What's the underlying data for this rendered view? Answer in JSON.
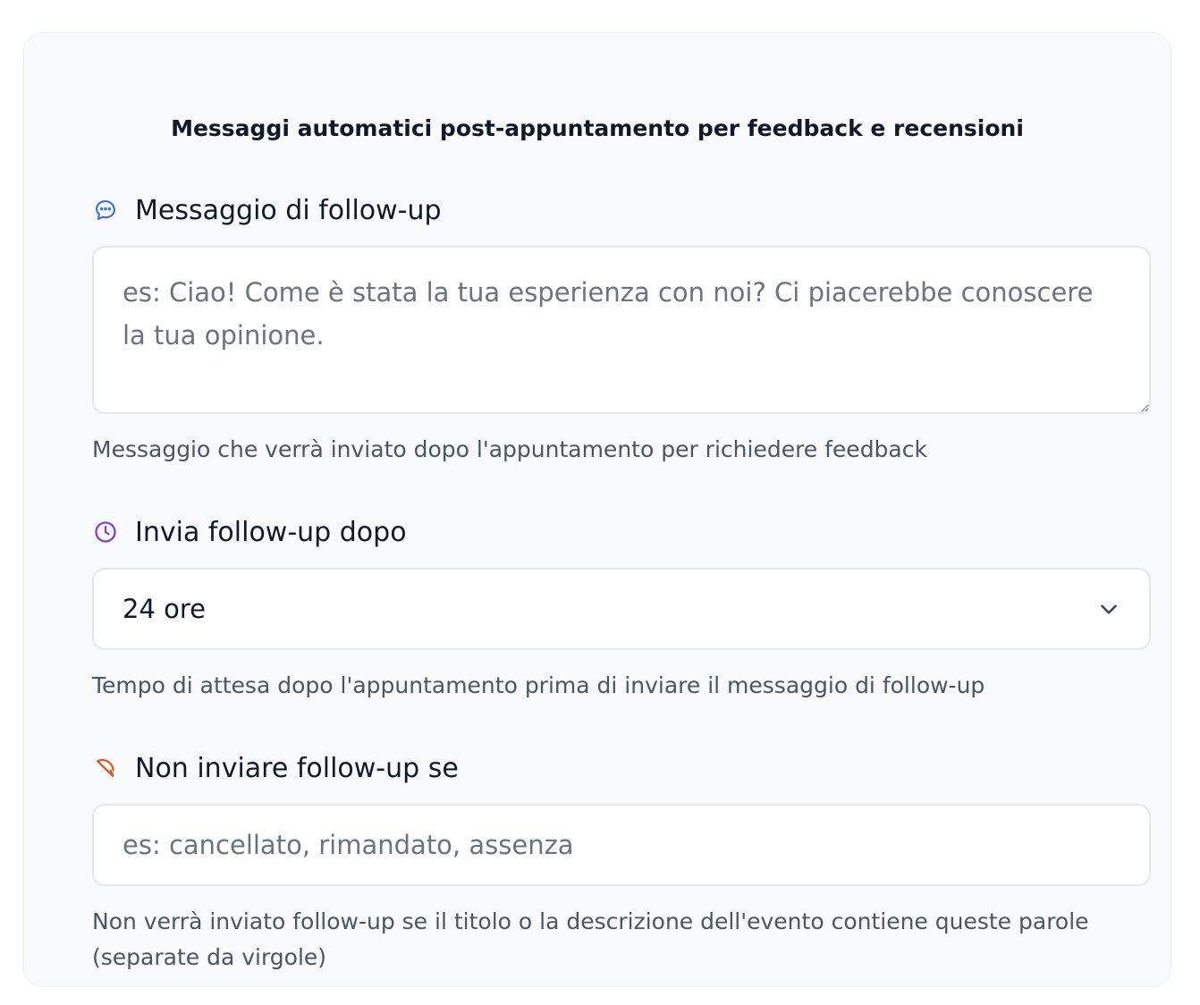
{
  "card": {
    "title": "Messaggi automatici post-appuntamento per feedback e recensioni"
  },
  "followup_message": {
    "label": "Messaggio di follow-up",
    "icon": "chat-bubble-icon",
    "icon_color": "#3b6fd8",
    "value": "",
    "placeholder": "es: Ciao! Come è stata la tua esperienza con noi? Ci piacerebbe conoscere la tua opinione.",
    "helper": "Messaggio che verrà inviato dopo l'appuntamento per richiedere feedback"
  },
  "send_after": {
    "label": "Invia follow-up dopo",
    "icon": "clock-icon",
    "icon_color": "#8b3fd1",
    "selected": "24 ore",
    "helper": "Tempo di attesa dopo l'appuntamento prima di inviare il messaggio di follow-up"
  },
  "exclude_keywords": {
    "label": "Non inviare follow-up se",
    "icon": "ban-icon",
    "icon_color": "#d1602c",
    "value": "",
    "placeholder": "es: cancellato, rimandato, assenza",
    "helper": "Non verrà inviato follow-up se il titolo o la descrizione dell'evento contiene queste parole (separate da virgole)"
  }
}
